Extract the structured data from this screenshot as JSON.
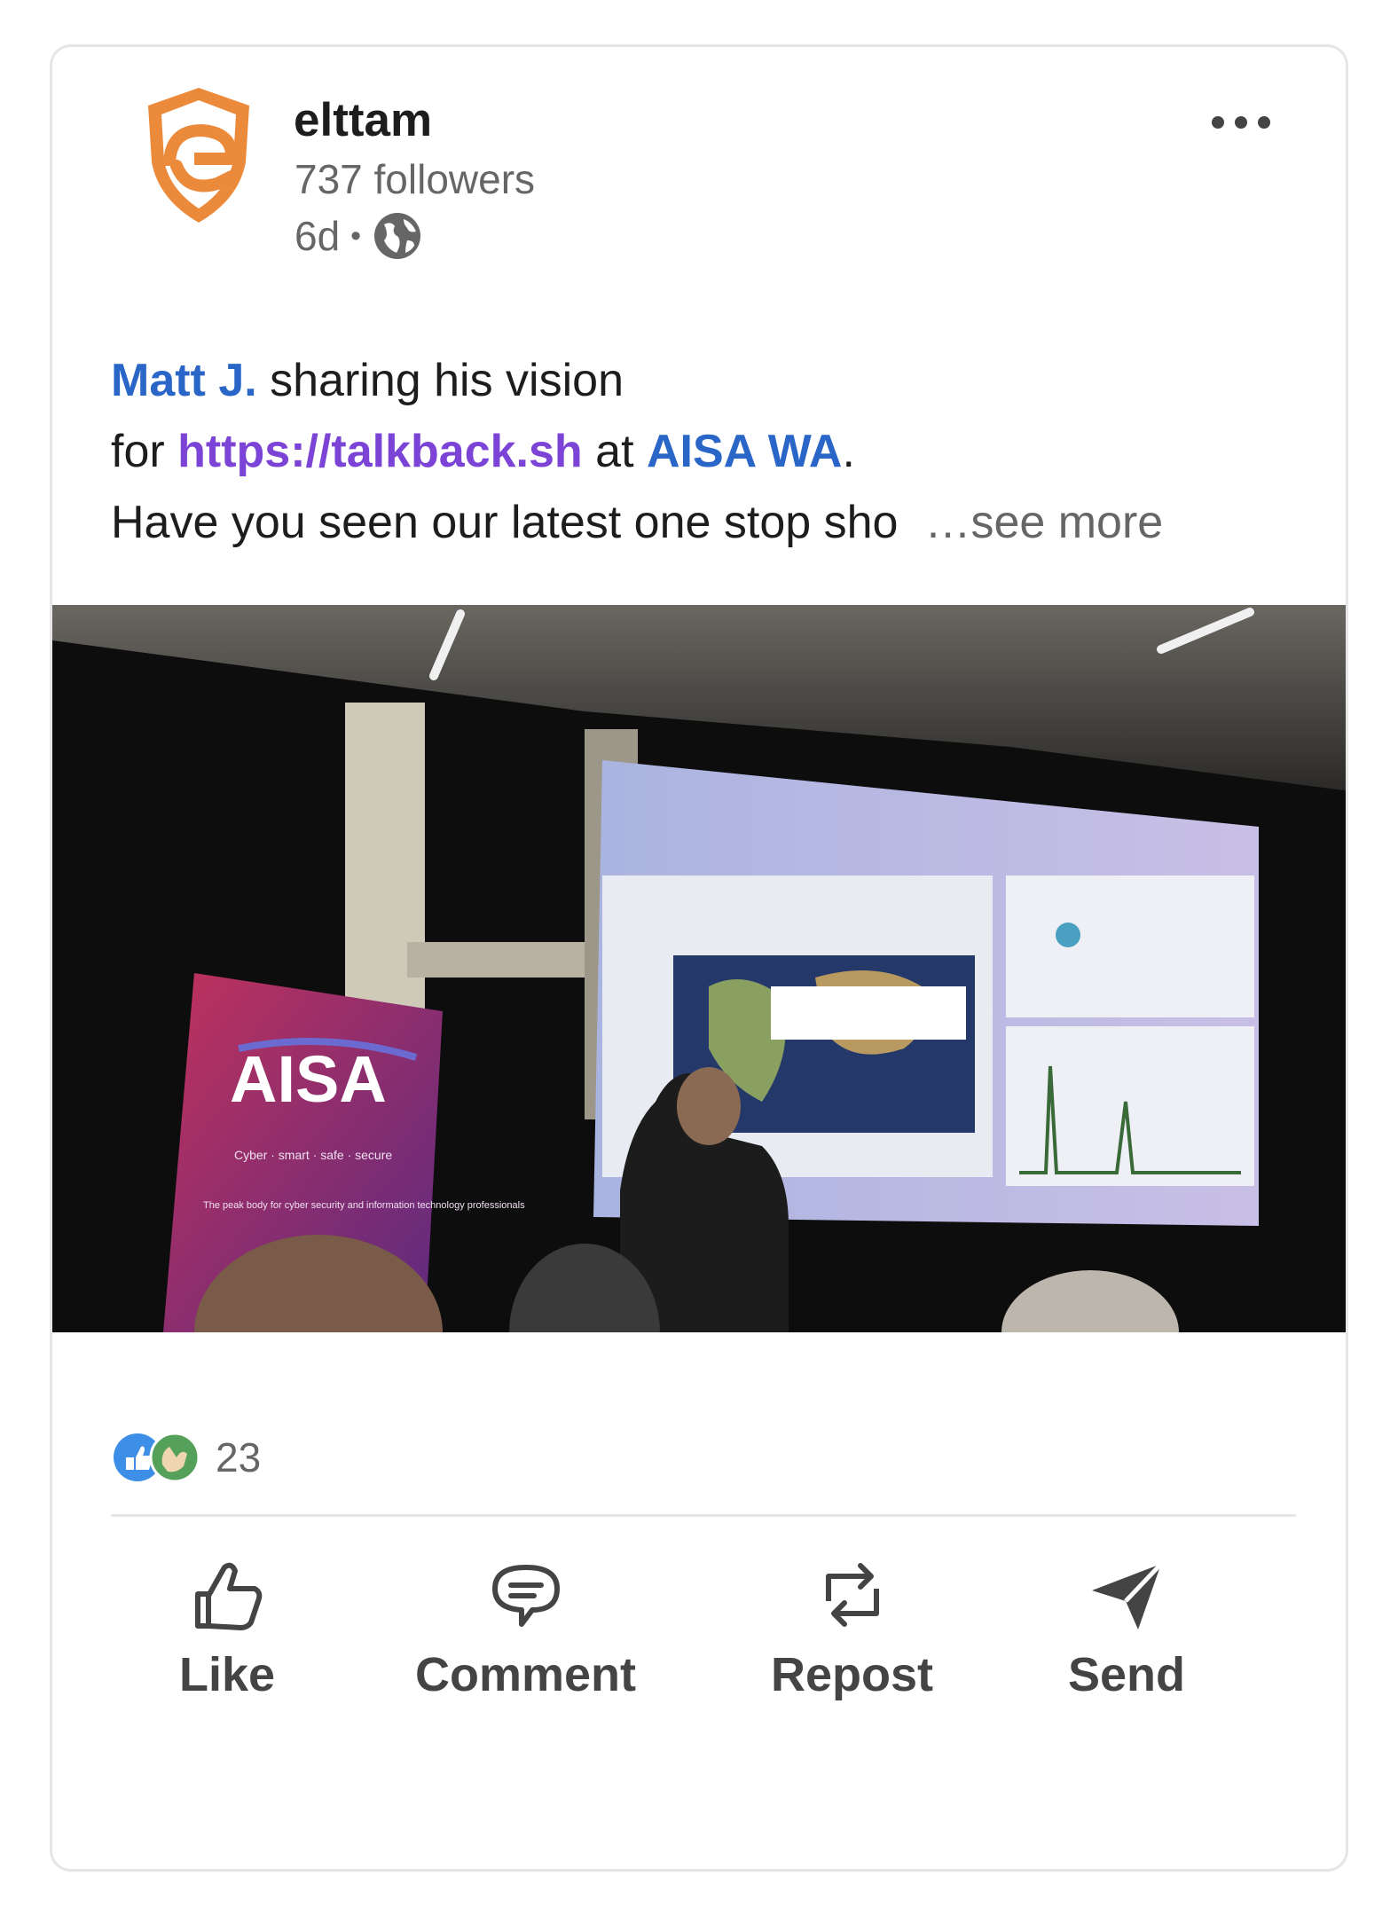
{
  "company": {
    "name": "elttam",
    "followers": "737 followers",
    "age": "6d",
    "separator": "•",
    "logo_icon": "shield-e-logo",
    "visibility_icon": "globe-icon",
    "brand_color": "#ec8a3c"
  },
  "menu": {
    "icon": "more-options-icon"
  },
  "post": {
    "mention": "Matt J.",
    "text_1": " sharing his vision",
    "text_2": "for ",
    "link": "https://talkback.sh",
    "text_3": " at ",
    "mention_2": "AISA WA",
    "text_4": ".",
    "text_5": "Have you seen our latest one stop sho",
    "see_more": "…see more"
  },
  "photo": {
    "banner_title": "AISA",
    "banner_subtitle": "Cyber · smart · safe · secure",
    "banner_tagline": "The peak body for cyber security and information technology professionals"
  },
  "reactions": {
    "count": "23",
    "icons": [
      "like-reaction-icon",
      "celebrate-reaction-icon"
    ]
  },
  "actions": [
    {
      "label": "Like",
      "icon": "thumbs-up-icon"
    },
    {
      "label": "Comment",
      "icon": "comment-icon"
    },
    {
      "label": "Repost",
      "icon": "repost-icon"
    },
    {
      "label": "Send",
      "icon": "send-icon"
    }
  ],
  "colors": {
    "mention": "#2a66c8",
    "link": "#7b43d6",
    "muted": "#666666",
    "border": "#e6e6e6"
  }
}
